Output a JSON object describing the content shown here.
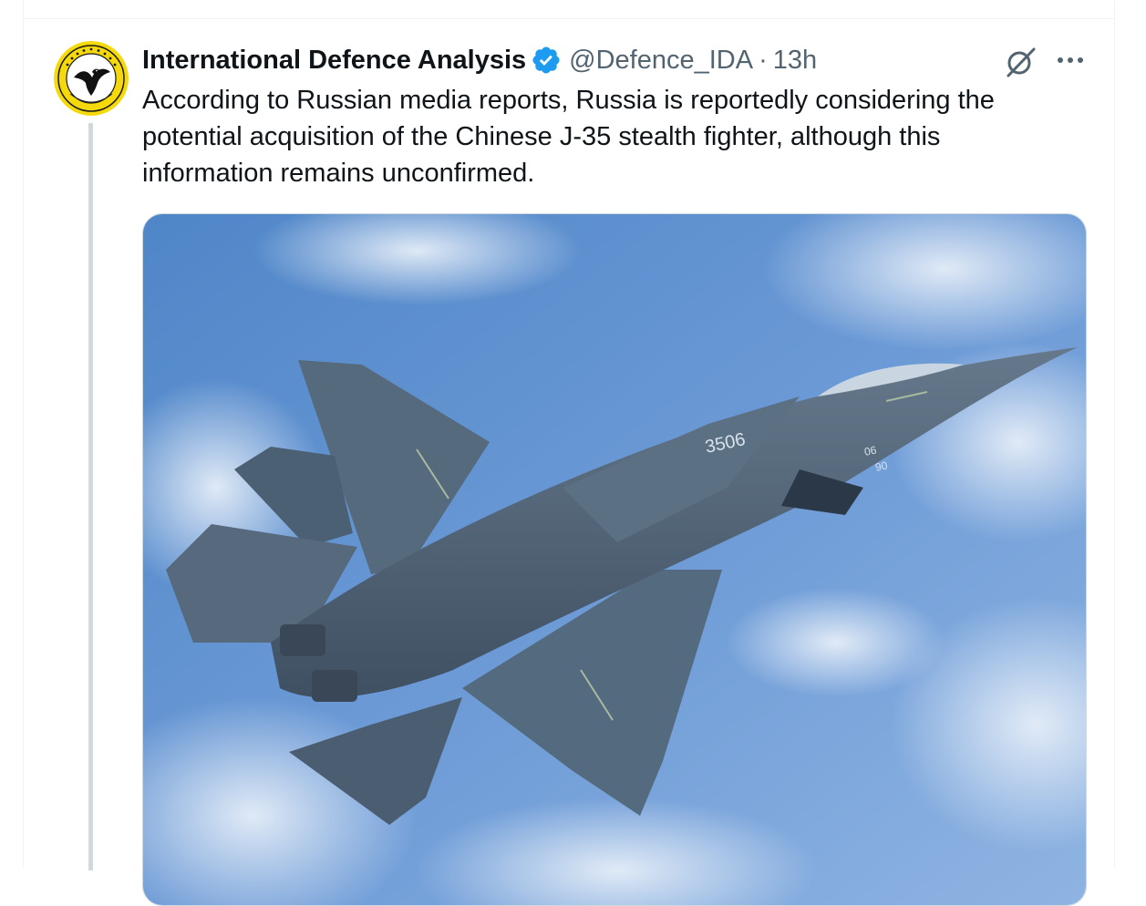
{
  "tweet": {
    "display_name": "International Defence Analysis",
    "handle": "@Defence_IDA",
    "separator": "·",
    "time": "13h",
    "text": "According to Russian media reports, Russia is reportedly considering the potential acquisition of the Chinese J-35 stealth fighter, although this information remains unconfirmed.",
    "avatar_text": "INTERNATIONAL DEFENCE ANALYSIS",
    "media_icon": "fighter-jet-photo",
    "aircraft_markings": [
      "3506",
      "06",
      "90"
    ]
  },
  "icons": {
    "verified": "verified-badge-icon",
    "grok": "grok-icon",
    "more": "more-options-icon"
  },
  "colors": {
    "verified": "#1d9bf0",
    "secondary_text": "#536471",
    "primary_text": "#0f1419",
    "thread_line": "#cfd9de",
    "sky": "#5b8fd0",
    "jet": "#4f6478",
    "avatar_ring": "#f5d90a"
  }
}
